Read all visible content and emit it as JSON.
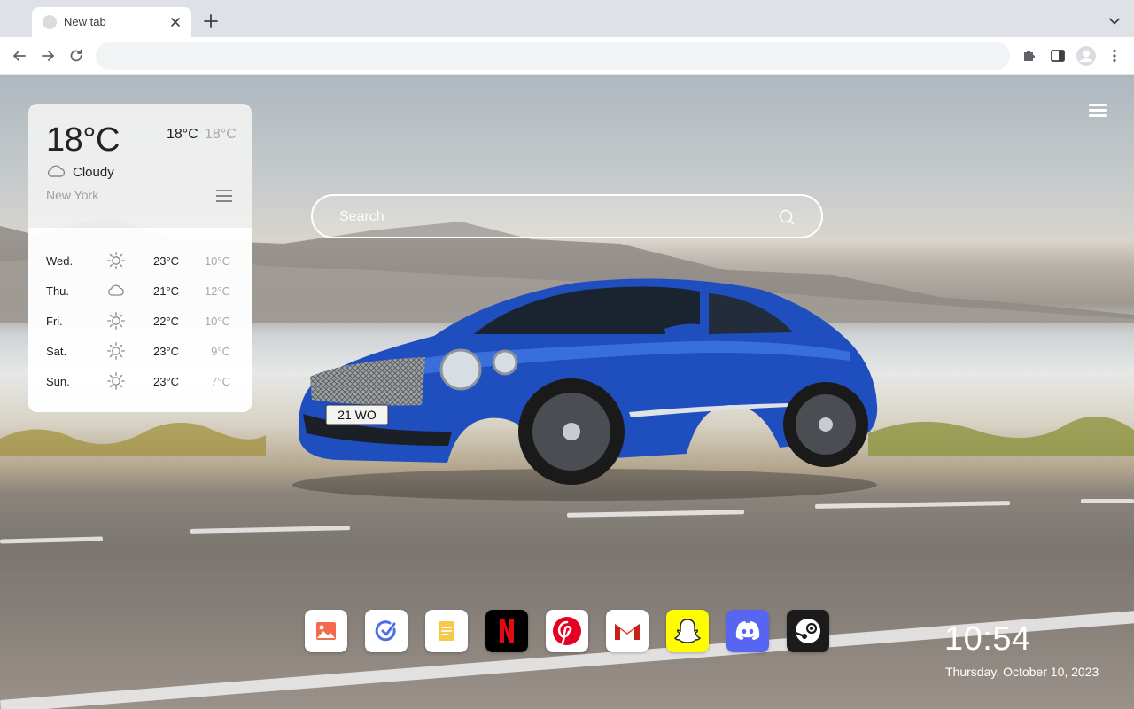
{
  "browser": {
    "tab_title": "New tab",
    "address_value": "",
    "icons": [
      "close-icon",
      "plus-icon",
      "chevron-down-icon",
      "back-icon",
      "forward-icon",
      "reload-icon",
      "puzzle-icon",
      "side-panel-icon",
      "profile-icon",
      "more-vert-icon"
    ]
  },
  "weather": {
    "current_temp": "18°C",
    "today_high": "18°C",
    "today_low": "18°C",
    "condition": "Cloudy",
    "condition_icon": "cloud-icon",
    "city": "New York",
    "forecast": [
      {
        "day": "Wed.",
        "icon": "sun-icon",
        "high": "23°C",
        "low": "10°C"
      },
      {
        "day": "Thu.",
        "icon": "cloud-icon",
        "high": "21°C",
        "low": "12°C"
      },
      {
        "day": "Fri.",
        "icon": "sun-icon",
        "high": "22°C",
        "low": "10°C"
      },
      {
        "day": "Sat.",
        "icon": "sun-icon",
        "high": "23°C",
        "low": "9°C"
      },
      {
        "day": "Sun.",
        "icon": "sun-icon",
        "high": "23°C",
        "low": "7°C"
      }
    ]
  },
  "search": {
    "placeholder": "Search",
    "icon": "search-icon"
  },
  "car": {
    "plate": "21 WO"
  },
  "dock": [
    {
      "name": "photos",
      "icon": "photo-icon",
      "color": "#ffffff"
    },
    {
      "name": "tasks",
      "icon": "check-circle-icon",
      "color": "#ffffff"
    },
    {
      "name": "notes",
      "icon": "notes-icon",
      "color": "#ffffff"
    },
    {
      "name": "netflix",
      "icon": "netflix-icon",
      "color": "#000000"
    },
    {
      "name": "pinterest",
      "icon": "pinterest-icon",
      "color": "#ffffff"
    },
    {
      "name": "gmail",
      "icon": "gmail-icon",
      "color": "#ffffff"
    },
    {
      "name": "snapchat",
      "icon": "snapchat-icon",
      "color": "#fffc00"
    },
    {
      "name": "discord",
      "icon": "discord-icon",
      "color": "#5865f2"
    },
    {
      "name": "steam",
      "icon": "steam-icon",
      "color": "#1b1b1b"
    }
  ],
  "clock": {
    "time": "10:54",
    "date": "Thursday, October 10, 2023"
  },
  "colors": {
    "chrome_bg": "#dee1e6",
    "car_blue": "#1f4fbf",
    "text_muted": "#a8a8a8"
  }
}
